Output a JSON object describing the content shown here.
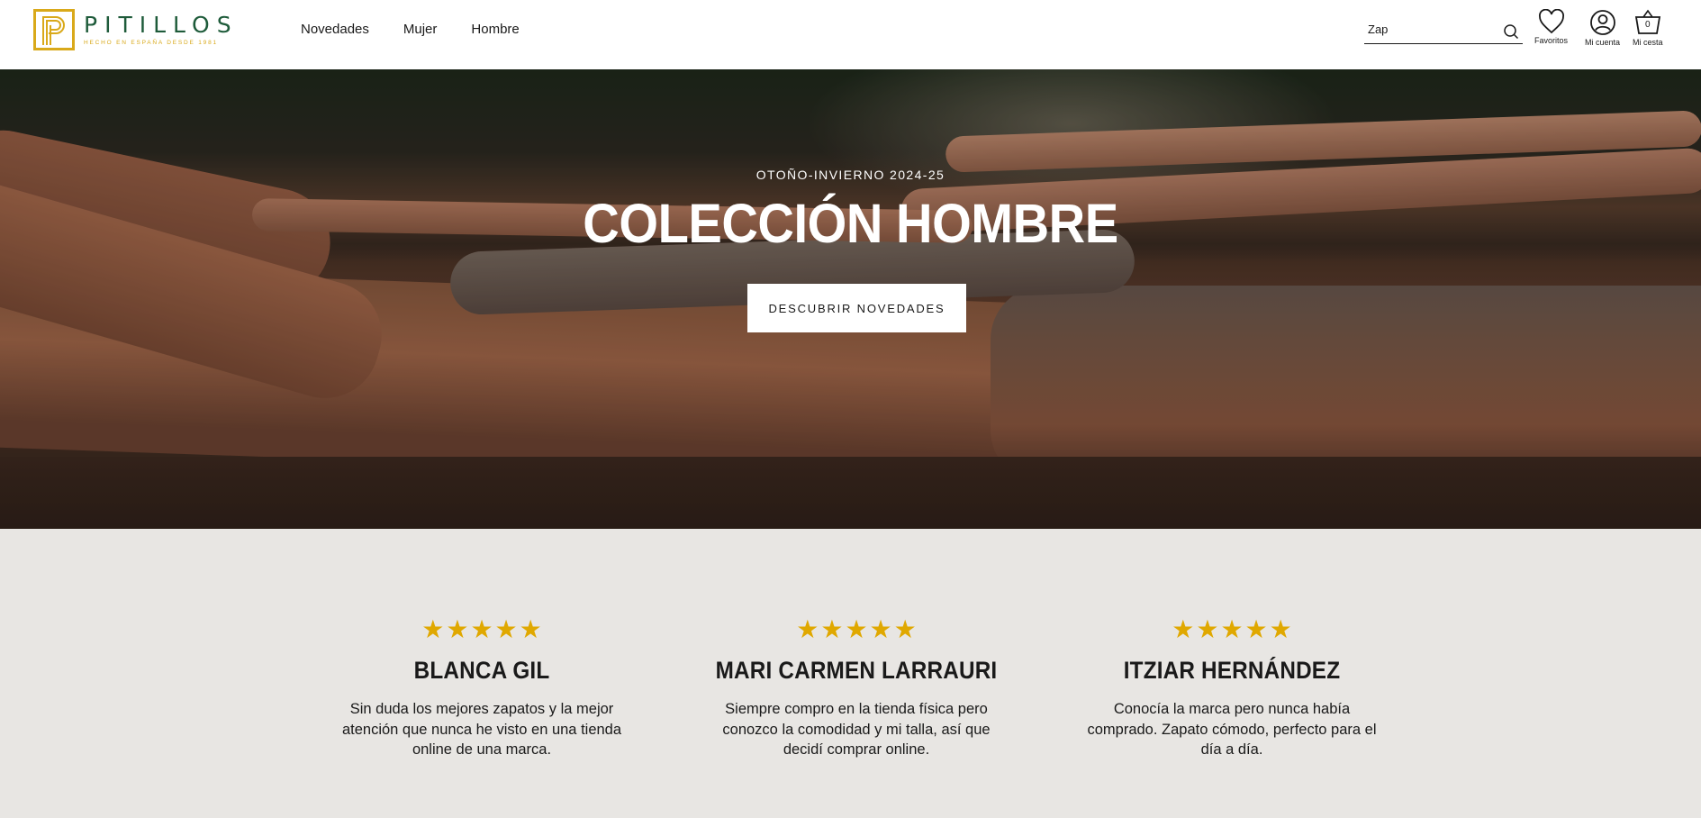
{
  "brand": {
    "name": "PITILLOS",
    "tagline": "HECHO EN ESPAÑA DESDE 1981",
    "primary_color": "#1e5b3a",
    "accent_color": "#d9a91a"
  },
  "nav": {
    "items": [
      {
        "label": "Novedades"
      },
      {
        "label": "Mujer"
      },
      {
        "label": "Hombre"
      }
    ]
  },
  "search": {
    "value": "Zap",
    "icon": "search-icon"
  },
  "header_actions": {
    "favorites_label": "Favoritos",
    "account_label": "Mi cuenta",
    "cart_label": "Mi cesta",
    "cart_count": "0"
  },
  "hero": {
    "eyebrow": "OTOÑO-INVIERNO 2024-25",
    "title": "COLECCIÓN HOMBRE",
    "button_label": "DESCUBRIR NOVEDADES"
  },
  "reviews": {
    "star_color": "#e0a800",
    "items": [
      {
        "rating": 5,
        "name": "BLANCA GIL",
        "text": "Sin duda los mejores zapatos y la mejor atención que nunca he visto en una tienda online de una marca."
      },
      {
        "rating": 5,
        "name": "MARI CARMEN LARRAURI",
        "text": "Siempre compro en la tienda física pero conozco la comodidad y mi talla, así que decidí comprar online."
      },
      {
        "rating": 5,
        "name": "ITZIAR HERNÁNDEZ",
        "text": "Conocía la marca pero nunca había comprado. Zapato cómodo, perfecto para el día a día."
      }
    ]
  }
}
